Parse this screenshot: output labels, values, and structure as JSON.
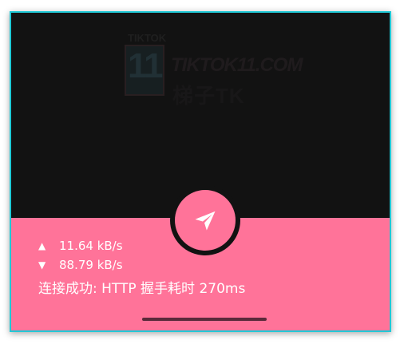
{
  "watermark": {
    "top": "TIKTOK",
    "number": "11",
    "domain": "TIKTOK11.COM",
    "subtitle": "梯子TK"
  },
  "send_button": {
    "icon": "paper-plane-icon"
  },
  "stats": {
    "upload_arrow": "▲",
    "upload_speed": "11.64 kB/s",
    "download_arrow": "▼",
    "download_speed": "88.79 kB/s",
    "status": "连接成功: HTTP 握手耗时 270ms"
  },
  "colors": {
    "accent": "#ff7399",
    "background": "#121212",
    "frame_border": "#20c9d6"
  }
}
